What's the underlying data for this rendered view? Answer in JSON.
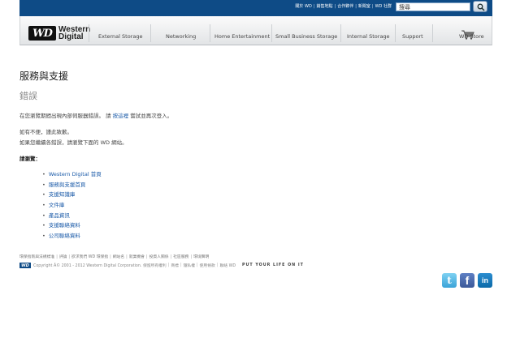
{
  "header": {
    "util_links": [
      "關於 WD",
      "銷售地點",
      "合作夥伴",
      "新聞室",
      "WD 社群"
    ],
    "search": {
      "value": "搜尋",
      "placeholder": "搜尋"
    },
    "logo": {
      "mark": "WD",
      "line1": "Western",
      "line2": "Digital"
    }
  },
  "nav": {
    "items": [
      "External Storage",
      "Networking",
      "Home Entertainment",
      "Small Business Storage",
      "Internal Storage",
      "Support",
      "WD Store"
    ]
  },
  "content": {
    "heading": "服務與支援",
    "error_title": "錯誤",
    "line1_before": "在您瀏覽期間出現內部伺服器錯誤。 請",
    "line1_link": "按這裡",
    "line1_after": "嘗試並再次登入。",
    "line2": "如有不便，謹此致歉。",
    "line3": "如果您繼續各錯誤，請瀏覽下面的 WD 網站。",
    "try_label": "請瀏覽：",
    "links": [
      "Western Digital 首頁",
      "服務與支援首頁",
      "支援知識庫",
      "文件庫",
      "產品資訊",
      "支援聯絡資料",
      "公司聯絡資料"
    ]
  },
  "footer": {
    "links": [
      "環保指南與法規標准",
      "評論",
      "欲求我們 WD 環保指",
      "網站名",
      "就業機會",
      "投資人關係",
      "社區服務",
      "環境聲明"
    ],
    "wd_mini": "WD",
    "copyright": "Copyright Â© 2001 - 2012 Western Digital Corporation. 保留所有權利",
    "legal_links": [
      "商標",
      "隱私權",
      "使用條款",
      "聯絡 WD"
    ],
    "tagline": "PUT YOUR LIFE ON IT"
  },
  "social": {
    "twitter": "t",
    "facebook": "f",
    "linkedin": "in"
  },
  "colors": {
    "topbar": "#0e4b86",
    "link": "#1a5aa8",
    "facebook": "#3b5998",
    "twitter": "#3aa3d8",
    "linkedin": "#0b6aa8"
  }
}
